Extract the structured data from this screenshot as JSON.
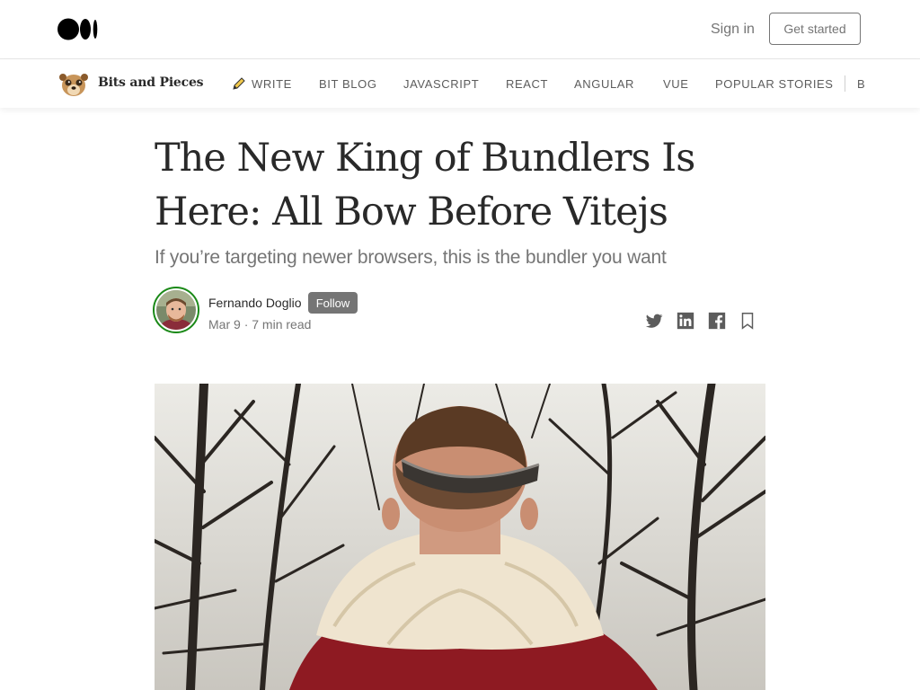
{
  "header": {
    "signin_label": "Sign in",
    "get_started_label": "Get started"
  },
  "publication": {
    "name": "Bits and Pieces",
    "nav": [
      "WRITE",
      "BIT BLOG",
      "JAVASCRIPT",
      "REACT",
      "ANGULAR",
      "VUE",
      "POPULAR STORIES"
    ],
    "nav_overflow": "B"
  },
  "article": {
    "title": "The New King of Bundlers Is Here: All Bow Before Vitejs",
    "subtitle": "If you’re targeting newer browsers, this is the bundler you want",
    "author": "Fernando Doglio",
    "follow_label": "Follow",
    "date": "Mar 9",
    "read_time": "7 min read"
  },
  "share_icons": [
    "twitter-icon",
    "linkedin-icon",
    "facebook-icon",
    "bookmark-icon"
  ],
  "colors": {
    "text": "#292929",
    "muted": "#757575",
    "follow_bg": "#757575",
    "avatar_ring": "#1a8917"
  }
}
